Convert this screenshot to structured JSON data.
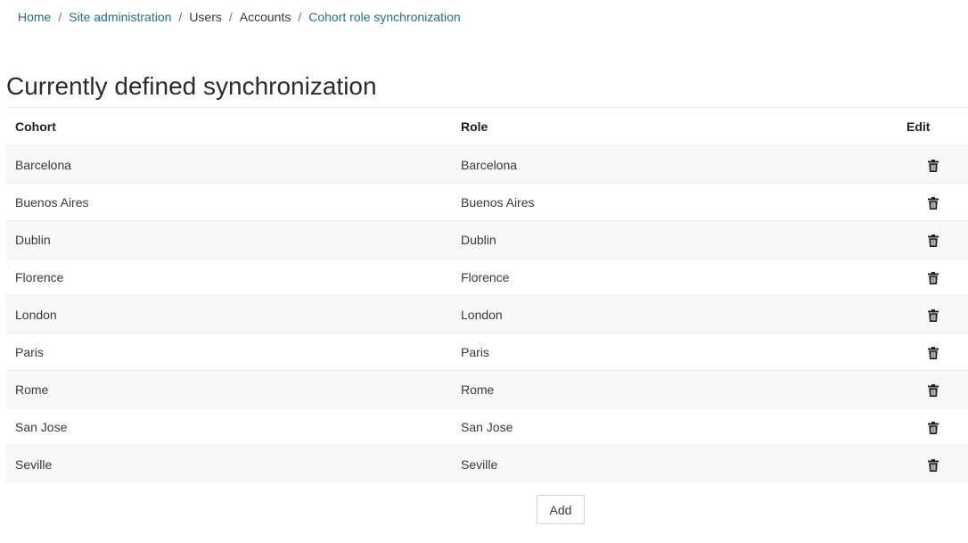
{
  "breadcrumb": [
    {
      "label": "Home",
      "link": true
    },
    {
      "label": "Site administration",
      "link": true
    },
    {
      "label": "Users",
      "link": false
    },
    {
      "label": "Accounts",
      "link": false
    },
    {
      "label": "Cohort role synchronization",
      "link": true
    }
  ],
  "page": {
    "title": "Currently defined synchronization"
  },
  "table": {
    "headers": {
      "cohort": "Cohort",
      "role": "Role",
      "edit": "Edit"
    },
    "rows": [
      {
        "cohort": "Barcelona",
        "role": "Barcelona",
        "action_icon": "trash-icon"
      },
      {
        "cohort": "Buenos Aires",
        "role": "Buenos Aires",
        "action_icon": "trash-icon"
      },
      {
        "cohort": "Dublin",
        "role": "Dublin",
        "action_icon": "trash-icon"
      },
      {
        "cohort": "Florence",
        "role": "Florence",
        "action_icon": "trash-icon"
      },
      {
        "cohort": "London",
        "role": "London",
        "action_icon": "trash-icon"
      },
      {
        "cohort": "Paris",
        "role": "Paris",
        "action_icon": "trash-icon"
      },
      {
        "cohort": "Rome",
        "role": "Rome",
        "action_icon": "trash-icon"
      },
      {
        "cohort": "San Jose",
        "role": "San Jose",
        "action_icon": "trash-icon"
      },
      {
        "cohort": "Seville",
        "role": "Seville",
        "action_icon": "trash-icon"
      }
    ]
  },
  "actions": {
    "add_label": "Add"
  },
  "colors": {
    "link": "#1f6f9f",
    "stripe": "#f8f8f8",
    "border": "#e9ecef"
  }
}
